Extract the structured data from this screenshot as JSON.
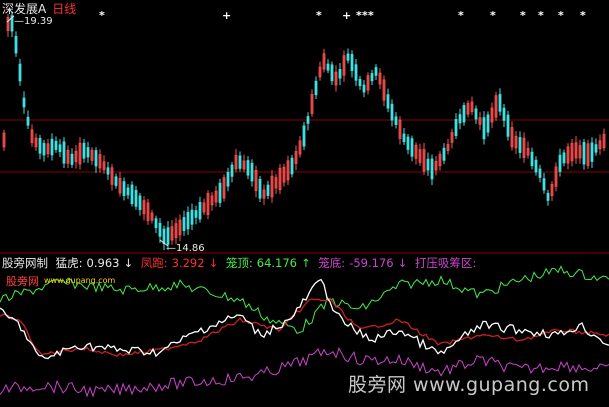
{
  "header": {
    "stock_name": "深发展A",
    "period": "日线"
  },
  "price_chart": {
    "high_label": "19.39",
    "low_label": "14.86",
    "high_value": 19.39,
    "low_value": 14.86
  },
  "indicator": {
    "title": "股旁网制",
    "items": [
      {
        "label": "猛虎:",
        "value": "0.963",
        "arrow": "↓",
        "color": "#e8e8e8"
      },
      {
        "label": "凤跑:",
        "value": "3.292",
        "arrow": "↓",
        "color": "#ff3030"
      },
      {
        "label": "笼顶:",
        "value": "64.176",
        "arrow": "↑",
        "color": "#44ee44"
      },
      {
        "label": "笼底:",
        "value": "-59.176",
        "arrow": "↓",
        "color": "#cc44cc"
      }
    ],
    "extra_label": "打压吸筹区:",
    "extra_color": "#cc44cc"
  },
  "watermarks": {
    "logo_text": "股旁网",
    "url_small": "www.gupang.com",
    "bottom_right": "股旁网 www.gupang.com"
  },
  "colors": {
    "up": "#ff5050",
    "down": "#40e0e0",
    "signal_white": "#ffffff",
    "signal_red": "#cc2020",
    "signal_green": "#44ee44",
    "signal_purple": "#cc44cc",
    "separator": "#8b0000"
  }
}
